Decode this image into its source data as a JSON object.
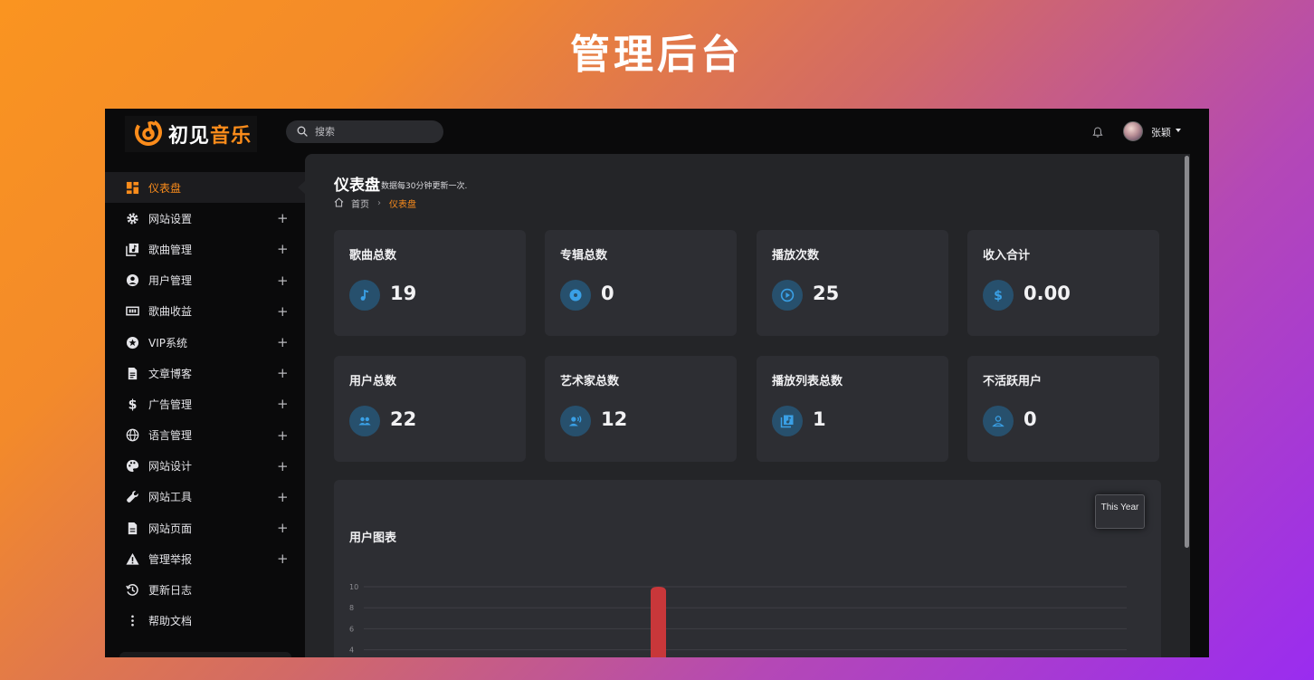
{
  "hero_title": "管理后台",
  "app": {
    "logo": {
      "text_white": "初见",
      "text_orange": "音乐"
    },
    "search": {
      "placeholder": "搜索"
    },
    "user": {
      "name": "张颖"
    }
  },
  "sidebar": {
    "items": [
      {
        "label": "仪表盘",
        "icon": "dashboard-icon",
        "active": true,
        "expandable": false
      },
      {
        "label": "网站设置",
        "icon": "gear-icon",
        "expandable": true
      },
      {
        "label": "歌曲管理",
        "icon": "music-library-icon",
        "expandable": true
      },
      {
        "label": "用户管理",
        "icon": "user-circle-icon",
        "expandable": true
      },
      {
        "label": "歌曲收益",
        "icon": "money-icon",
        "expandable": true
      },
      {
        "label": "VIP系统",
        "icon": "star-icon",
        "expandable": true
      },
      {
        "label": "文章博客",
        "icon": "article-icon",
        "expandable": true
      },
      {
        "label": "广告管理",
        "icon": "dollar-icon",
        "expandable": true
      },
      {
        "label": "语言管理",
        "icon": "globe-icon",
        "expandable": true
      },
      {
        "label": "网站设计",
        "icon": "palette-icon",
        "expandable": true
      },
      {
        "label": "网站工具",
        "icon": "wrench-icon",
        "expandable": true
      },
      {
        "label": "网站页面",
        "icon": "page-icon",
        "expandable": true
      },
      {
        "label": "管理举报",
        "icon": "warning-icon",
        "expandable": true
      },
      {
        "label": "更新日志",
        "icon": "history-icon",
        "expandable": false
      },
      {
        "label": "帮助文档",
        "icon": "more-vertical-icon",
        "expandable": false
      }
    ],
    "plus_symbol": "+"
  },
  "main": {
    "title": "仪表盘",
    "subtitle": "数据每30分钟更新一次.",
    "breadcrumb": {
      "home": "首页",
      "separator": "›",
      "current": "仪表盘"
    },
    "stats": [
      {
        "label": "歌曲总数",
        "value": "19",
        "icon": "music-note-icon"
      },
      {
        "label": "专辑总数",
        "value": "0",
        "icon": "album-disc-icon"
      },
      {
        "label": "播放次数",
        "value": "25",
        "icon": "play-circle-icon"
      },
      {
        "label": "收入合计",
        "value": "0.00",
        "icon": "dollar-icon"
      },
      {
        "label": "用户总数",
        "value": "22",
        "icon": "users-icon"
      },
      {
        "label": "艺术家总数",
        "value": "12",
        "icon": "artist-voice-icon"
      },
      {
        "label": "播放列表总数",
        "value": "1",
        "icon": "playlist-icon"
      },
      {
        "label": "不活跃用户",
        "value": "0",
        "icon": "inactive-user-icon"
      }
    ],
    "chart": {
      "title": "用户图表",
      "period_button": "This Year"
    }
  },
  "colors": {
    "accent": "#fb8c1b",
    "stat_icon_bg": "#27506d",
    "stat_icon_fg": "#3aa0e6",
    "bar": "#c8373a"
  },
  "chart_data": {
    "type": "bar",
    "title": "用户图表",
    "y_ticks": [
      4,
      6,
      8,
      10
    ],
    "ylim": [
      4,
      10
    ],
    "values": [
      10
    ],
    "grid": true,
    "legend": "none"
  }
}
